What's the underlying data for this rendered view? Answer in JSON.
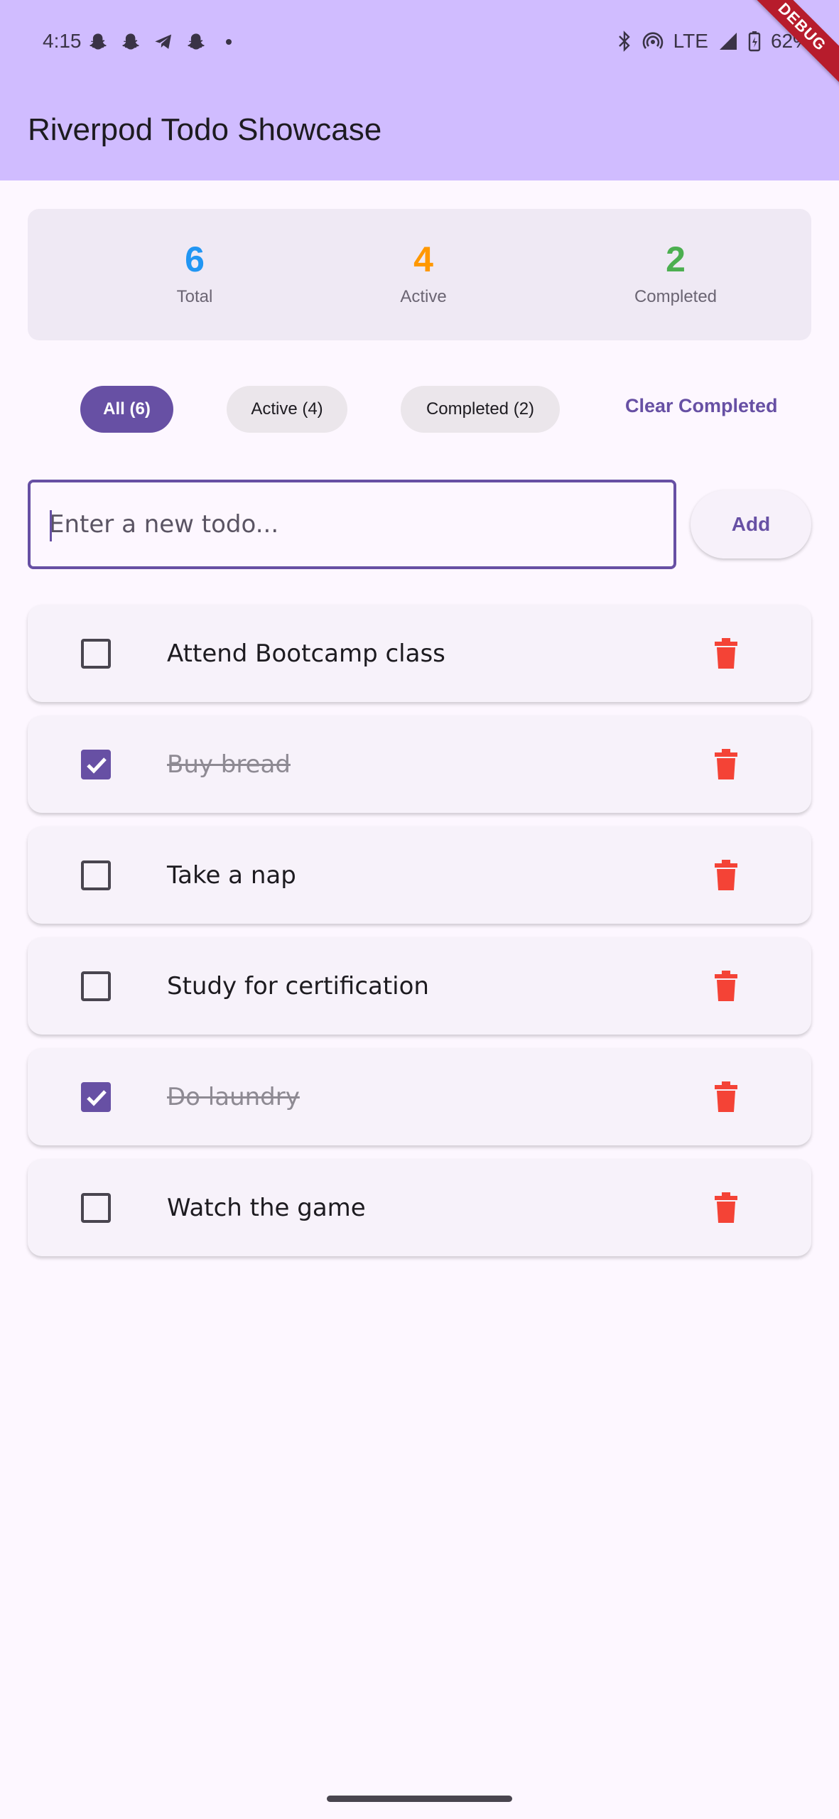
{
  "status_bar": {
    "time": "4:15",
    "left_icons": [
      "snapchat-icon",
      "snapchat-icon",
      "telegram-icon",
      "snapchat-icon",
      "dot-icon"
    ],
    "network": "LTE",
    "battery": "62%"
  },
  "debug_banner": "DEBUG",
  "app": {
    "title": "Riverpod Todo Showcase"
  },
  "stats": {
    "total": {
      "value": "6",
      "label": "Total",
      "color": "#2196f3"
    },
    "active": {
      "value": "4",
      "label": "Active",
      "color": "#ff9800"
    },
    "completed": {
      "value": "2",
      "label": "Completed",
      "color": "#4caf50"
    }
  },
  "filters": {
    "selected": "All (6)",
    "items": [
      {
        "label": "All (6)"
      },
      {
        "label": "Active (4)"
      },
      {
        "label": "Completed (2)"
      }
    ],
    "clear_completed": "Clear Completed"
  },
  "new_todo": {
    "value": "",
    "placeholder": "Enter a new todo...",
    "add_label": "Add"
  },
  "todos": [
    {
      "title": "Attend Bootcamp class",
      "completed": false
    },
    {
      "title": "Buy bread",
      "completed": true
    },
    {
      "title": "Take a nap",
      "completed": false
    },
    {
      "title": "Study for certification",
      "completed": false
    },
    {
      "title": "Do laundry",
      "completed": true
    },
    {
      "title": "Watch the game",
      "completed": false
    }
  ],
  "colors": {
    "primary": "#6750a4",
    "app_bar": "#d0bcff",
    "delete": "#f44336"
  }
}
